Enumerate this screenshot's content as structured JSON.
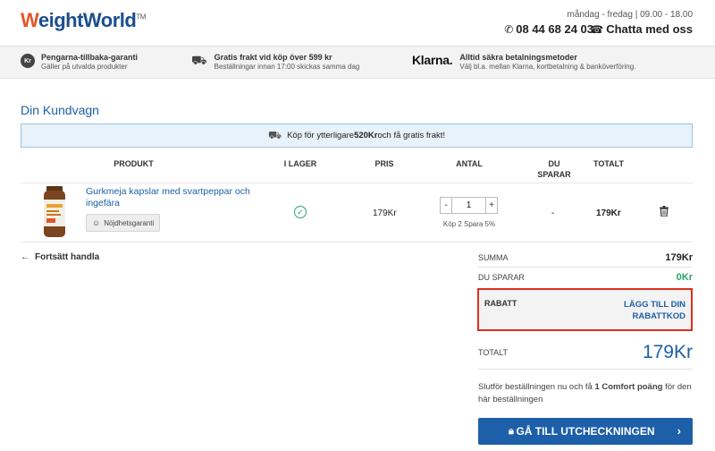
{
  "header": {
    "logo": {
      "brand": "WeightWorld",
      "tm": "TM"
    },
    "hours": "måndag - fredag | 09.00 - 18.00",
    "phone": "08 44 68 24 03",
    "chat": "Chatta med oss"
  },
  "usps": [
    {
      "badge": "Kr",
      "title": "Pengarna-tillbaka-garanti",
      "text": "Gäller på utvalda produkter"
    },
    {
      "title": "Gratis frakt vid köp över 599 kr",
      "text": "Beställningar innan 17:00 skickas samma dag"
    },
    {
      "brand": "Klarna.",
      "title": "Alltid säkra betalningsmetoder",
      "text": "Välj bl.a. mellan Klarna, kortbetalning & banköverföring."
    }
  ],
  "cart": {
    "title": "Din Kundvagn",
    "free_shipping": {
      "before": "Köp för ytterligare ",
      "amount": "520Kr",
      "after": " och få gratis frakt!"
    },
    "columns": {
      "product": "PRODUKT",
      "stock": "I LAGER",
      "price": "PRIS",
      "qty": "ANTAL",
      "save_1": "DU",
      "save_2": "SPARAR",
      "total": "TOTALT"
    },
    "item": {
      "name": "Gurkmeja kapslar med svartpeppar och ingefära",
      "guarantee": "Nöjdhetsgaranti",
      "price": "179Kr",
      "minus": "-",
      "qty": "1",
      "plus": "+",
      "promo": "Köp 2 Spara 5%",
      "saving": "-",
      "total": "179Kr"
    },
    "continue": "Fortsätt handla"
  },
  "summary": {
    "sum_label": "SUMMA",
    "sum_value": "179Kr",
    "save_label": "DU SPARAR",
    "save_value": "0Kr",
    "discount_label": "RABATT",
    "discount_link": "LÄGG TILL DIN RABATTKOD",
    "total_label": "TOTALT",
    "total_value": "179Kr",
    "points_before": "Slutför beställningen nu och få ",
    "points_bold": "1 Comfort poäng",
    "points_after": " för den här beställningen",
    "checkout": "GÅ TILL UTCHECKNINGEN"
  },
  "colors": {
    "brand_blue": "#1d5fa8",
    "accent_orange": "#e2562c",
    "highlight_red": "#d9311d",
    "success_green": "#2aa36b"
  }
}
